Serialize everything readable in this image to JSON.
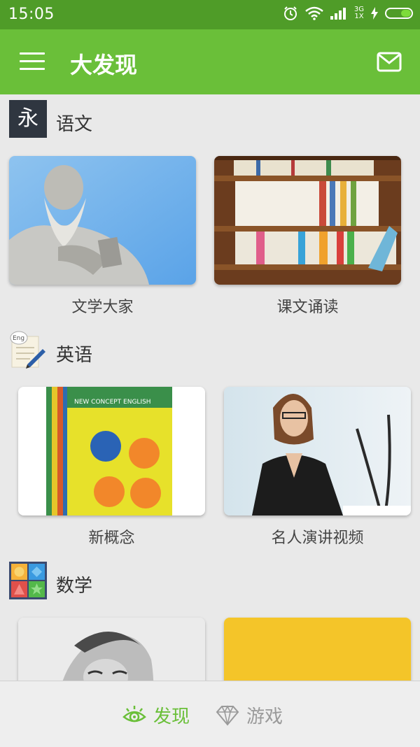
{
  "status_bar": {
    "time": "15:05",
    "network_top": "3G",
    "network_bottom": "1X"
  },
  "app_bar": {
    "title": "大发现",
    "menu_icon": "hamburger-menu-icon",
    "action_icon": "mail-icon"
  },
  "sections": [
    {
      "title": "语文",
      "icon": "calligraphy-yong-icon",
      "icon_glyph": "永",
      "cards": [
        {
          "label": "文学大家",
          "image": "confucius-statue-photo"
        },
        {
          "label": "课文诵读",
          "image": "bookshelf-photo"
        }
      ]
    },
    {
      "title": "英语",
      "icon": "english-notebook-pen-icon",
      "icon_text": "Eng",
      "cards": [
        {
          "label": "新概念",
          "image": "new-concept-english-books-photo",
          "book_text": "NEW CONCEPT ENGLISH"
        },
        {
          "label": "名人演讲视频",
          "image": "woman-speaker-podium-photo"
        }
      ]
    },
    {
      "title": "数学",
      "icon": "shapes-grid-icon",
      "cards": [
        {
          "label": "",
          "image": "engraving-portrait-photo"
        },
        {
          "label": "",
          "image": "yellow-background-photo"
        }
      ]
    }
  ],
  "bottom_nav": {
    "tabs": [
      {
        "label": "发现",
        "icon": "eye-icon",
        "active": true
      },
      {
        "label": "游戏",
        "icon": "diamond-icon",
        "active": false
      }
    ]
  },
  "colors": {
    "status_bar": "#4f9c28",
    "app_bar": "#6abf39",
    "active_tab": "#6abf39",
    "inactive_tab": "#9a9a9a",
    "background": "#e9e9e9"
  }
}
